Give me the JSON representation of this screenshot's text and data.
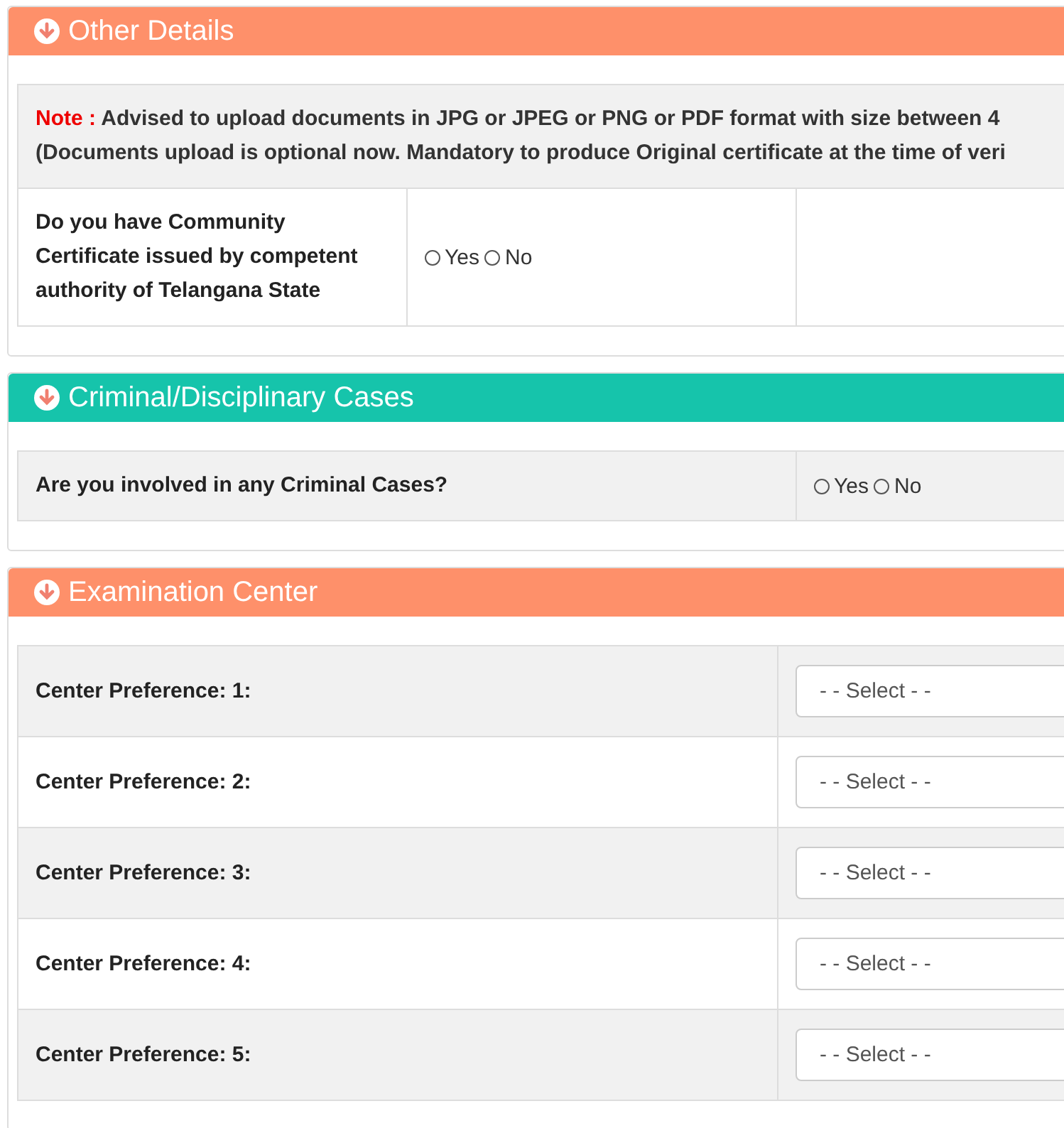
{
  "sections": [
    {
      "title": "Other Details",
      "color": "#fe906a",
      "note": {
        "label": "Note :",
        "text": "Advised to upload documents in JPG or JPEG or PNG or PDF format with size between 4",
        "line2": "(Documents upload is optional now. Mandatory to produce Original certificate at the time of veri"
      },
      "rows": [
        {
          "kind": "radio-split",
          "label": "Do you have Community Certificate issued by competent authority of Telangana State",
          "options": [
            {
              "label": "Yes",
              "selected": false
            },
            {
              "label": "No",
              "selected": false
            }
          ]
        }
      ]
    },
    {
      "title": "Criminal/Disciplinary Cases",
      "color": "#16c4ab",
      "rows": [
        {
          "kind": "radio",
          "label": "Are you involved in any Criminal Cases?",
          "options": [
            {
              "label": "Yes",
              "selected": false
            },
            {
              "label": "No",
              "selected": false
            }
          ]
        }
      ]
    },
    {
      "title": "Examination Center",
      "color": "#fe906a",
      "rows": [
        {
          "kind": "select",
          "label": "Center Preference: 1:",
          "value": "- - Select - -"
        },
        {
          "kind": "select",
          "label": "Center Preference: 2:",
          "value": "- - Select - -"
        },
        {
          "kind": "select",
          "label": "Center Preference: 3:",
          "value": "- - Select - -"
        },
        {
          "kind": "select",
          "label": "Center Preference: 4:",
          "value": "- - Select - -"
        },
        {
          "kind": "select",
          "label": "Center Preference: 5:",
          "value": "- - Select - -"
        }
      ]
    }
  ]
}
